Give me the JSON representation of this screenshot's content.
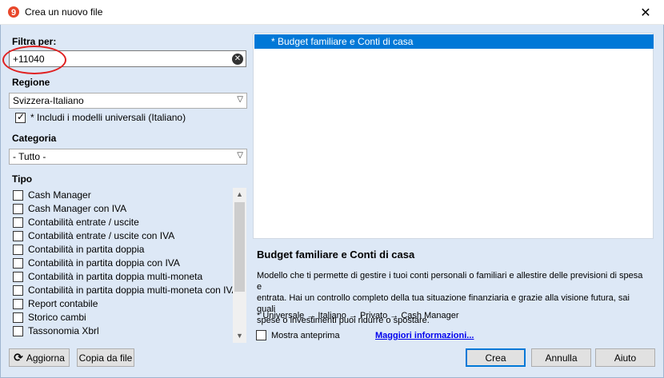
{
  "window": {
    "title": "Crea un nuovo file",
    "close_glyph": "✕"
  },
  "filter": {
    "label": "Filtra per:",
    "value": "+11040",
    "clear_icon": "clear-circle-icon"
  },
  "region": {
    "label": "Regione",
    "selected": "Svizzera-Italiano",
    "include_universal": {
      "label": "* Includi i modelli universali (Italiano)",
      "checked": true
    }
  },
  "category": {
    "label": "Categoria",
    "selected": "- Tutto -"
  },
  "tipo": {
    "label": "Tipo",
    "items": [
      "Cash Manager",
      "Cash Manager con IVA",
      "Contabilità entrate / uscite",
      "Contabilità entrate / uscite con IVA",
      "Contabilità in partita doppia",
      "Contabilità in partita doppia con IVA",
      "Contabilità in partita doppia multi-moneta",
      "Contabilità in partita doppia multi-moneta con IVA",
      "Report contabile",
      "Storico cambi",
      "Tassonomia Xbrl"
    ]
  },
  "buttons": {
    "refresh": "Aggiorna",
    "copy_from_file": "Copia da file",
    "create": "Crea",
    "cancel": "Annulla",
    "help": "Aiuto"
  },
  "results": [
    "* Budget familiare e Conti di casa"
  ],
  "description": {
    "title": "Budget familiare e Conti di casa",
    "line1": "Modello che ti permette di gestire i tuoi conti personali o familiari e allestire delle previsioni di spesa e",
    "line2": "entrata. Hai un controllo completo della tua situazione finanziaria e grazie alla visione futura, sai quali",
    "line3": "spese o investimenti puoi ridurre o spostare.",
    "tags": "* Universale → Italiano → Privato → Cash Manager"
  },
  "preview": {
    "label": "Mostra anteprima",
    "checked": false
  },
  "more_info": "Maggiori informazioni...",
  "colors": {
    "background": "#dde8f6",
    "selection": "#0078d7",
    "highlight_ellipse": "#e02020"
  }
}
